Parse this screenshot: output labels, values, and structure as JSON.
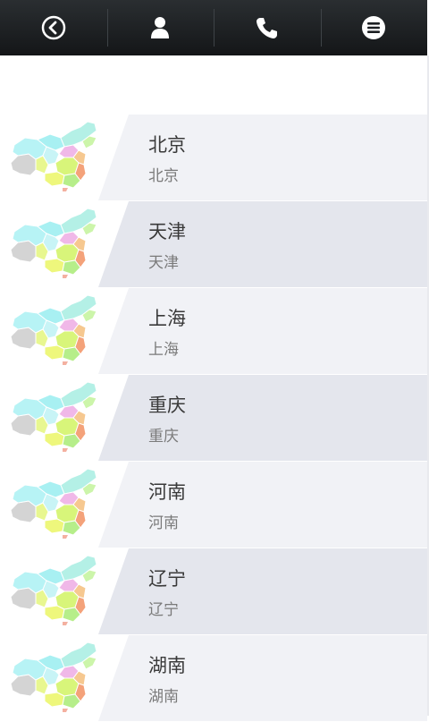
{
  "colors": {
    "topbar": "#1c1f22",
    "row_light": "#f1f2f6",
    "row_dark": "#e4e6ed"
  },
  "toolbar": {
    "buttons": [
      {
        "name": "back-button",
        "icon": "back-circle-icon"
      },
      {
        "name": "profile-button",
        "icon": "person-icon"
      },
      {
        "name": "call-button",
        "icon": "phone-icon"
      },
      {
        "name": "menu-button",
        "icon": "menu-list-icon"
      }
    ]
  },
  "regions": [
    {
      "title": "北京",
      "subtitle": "北京",
      "icon": "china-map-icon"
    },
    {
      "title": "天津",
      "subtitle": "天津",
      "icon": "china-map-icon"
    },
    {
      "title": "上海",
      "subtitle": "上海",
      "icon": "china-map-icon"
    },
    {
      "title": "重庆",
      "subtitle": "重庆",
      "icon": "china-map-icon"
    },
    {
      "title": "河南",
      "subtitle": "河南",
      "icon": "china-map-icon"
    },
    {
      "title": "辽宁",
      "subtitle": "辽宁",
      "icon": "china-map-icon"
    },
    {
      "title": "湖南",
      "subtitle": "湖南",
      "icon": "china-map-icon"
    }
  ]
}
